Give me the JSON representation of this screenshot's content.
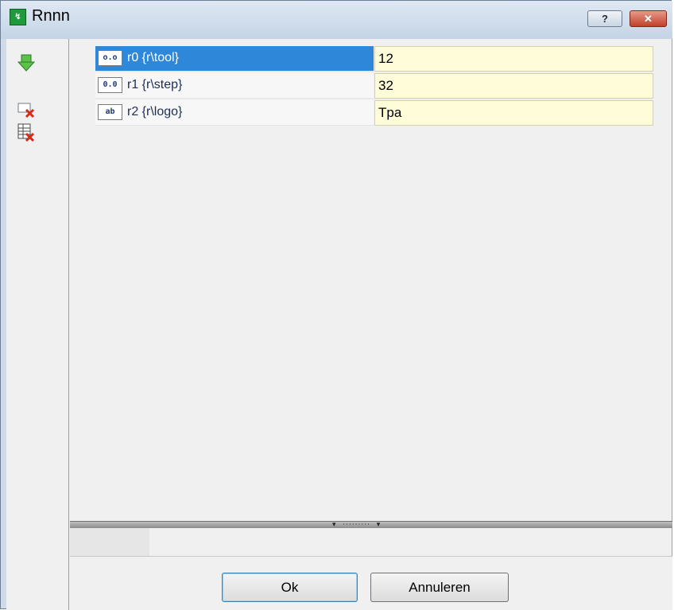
{
  "window": {
    "title": "Rnnn",
    "app_icon": "app-icon",
    "help_label": "?",
    "close_label": "✕"
  },
  "toolbar": {
    "tools": [
      {
        "name": "download-arrow-icon"
      },
      {
        "name": "delete-field-icon"
      },
      {
        "name": "delete-table-icon"
      }
    ]
  },
  "parameters": [
    {
      "type_badge": "o.o",
      "name": "r0 {r\\tool}",
      "value": "12",
      "selected": true
    },
    {
      "type_badge": "0.0",
      "name": "r1 {r\\step}",
      "value": "32",
      "selected": false
    },
    {
      "type_badge": "ab",
      "name": "r2 {r\\logo}",
      "value": "Tpa",
      "selected": false
    }
  ],
  "buttons": {
    "ok": "Ok",
    "cancel": "Annuleren"
  },
  "colors": {
    "selection": "#2f87d9",
    "value_background": "#fffcd9",
    "close_button": "#c0412a"
  }
}
